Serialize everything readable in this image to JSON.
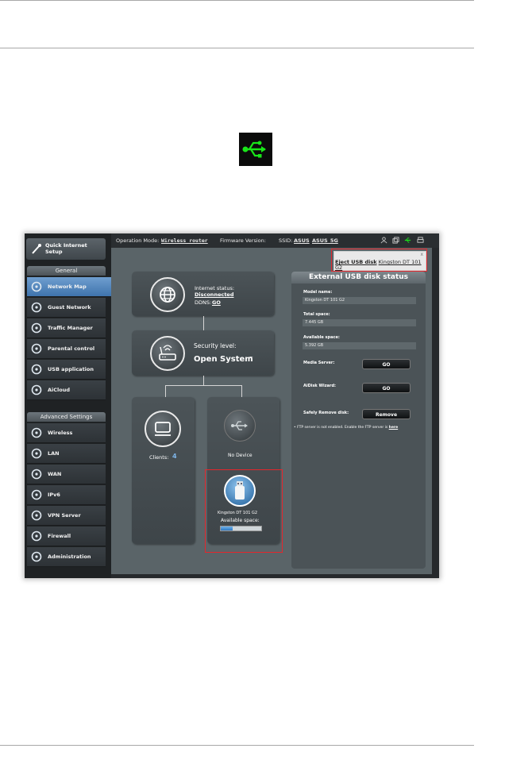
{
  "usb_icon": "usb-icon",
  "top_bar": {
    "operation_mode_label": "Operation Mode:",
    "operation_mode_value": "Wireless router",
    "firmware_label": "Firmware Version:",
    "ssid_label": "SSID:",
    "ssid_1": "ASUS",
    "ssid_2": "ASUS_5G",
    "icons": [
      "user-icon",
      "copy-icon",
      "usb-icon",
      "printer-icon"
    ]
  },
  "sidebar": {
    "quick_setup": "Quick Internet Setup",
    "general_header": "General",
    "general_items": [
      {
        "label": "Network Map",
        "icon": "network-map-icon",
        "active": true
      },
      {
        "label": "Guest Network",
        "icon": "guest-network-icon"
      },
      {
        "label": "Traffic Manager",
        "icon": "traffic-manager-icon"
      },
      {
        "label": "Parental control",
        "icon": "lock-icon"
      },
      {
        "label": "USB application",
        "icon": "puzzle-icon"
      },
      {
        "label": "AiCloud",
        "icon": "cloud-icon"
      }
    ],
    "advanced_header": "Advanced Settings",
    "advanced_items": [
      {
        "label": "Wireless",
        "icon": "wifi-icon"
      },
      {
        "label": "LAN",
        "icon": "home-icon"
      },
      {
        "label": "WAN",
        "icon": "globe-icon"
      },
      {
        "label": "IPv6",
        "icon": "globe-v6-icon"
      },
      {
        "label": "VPN Server",
        "icon": "vpn-icon"
      },
      {
        "label": "Firewall",
        "icon": "shield-icon"
      },
      {
        "label": "Administration",
        "icon": "admin-icon"
      }
    ]
  },
  "network_map": {
    "internet_status_label": "Internet status:",
    "internet_status_value": "Disconnected",
    "ddns_label": "DDNS:",
    "ddns_value": "GO",
    "security_label": "Security level:",
    "security_value": "Open System",
    "clients_label": "Clients:",
    "clients_value": "4",
    "usb_slot_label": "No Device",
    "usb_disk_name": "Kingston DT 101 G2",
    "available_space_label": "Available space:",
    "available_space_fraction": 0.3
  },
  "eject_popup": {
    "eject_label": "Eject USB disk",
    "disk_name": "Kingston DT 101 G2",
    "close": "x"
  },
  "usb_panel": {
    "title": "External USB disk status",
    "model_name_label": "Model name:",
    "model_name_value": "Kingston DT 101 G2",
    "total_space_label": "Total space:",
    "total_space_value": "7.445 GB",
    "available_space_label": "Available space:",
    "available_space_value": "5.392 GB",
    "media_server_label": "Media Server:",
    "media_server_button": "GO",
    "aidisk_label": "AiDisk Wizard:",
    "aidisk_button": "GO",
    "safely_remove_label": "Safely Remove disk:",
    "remove_button": "Remove",
    "ftp_note": "FTP server is not enabled. Enable the FTP server is",
    "ftp_link": "here"
  },
  "colors": {
    "active_menu": "#4f86c1",
    "usb_green": "#19e619",
    "highlight_red": "#e4262c"
  }
}
